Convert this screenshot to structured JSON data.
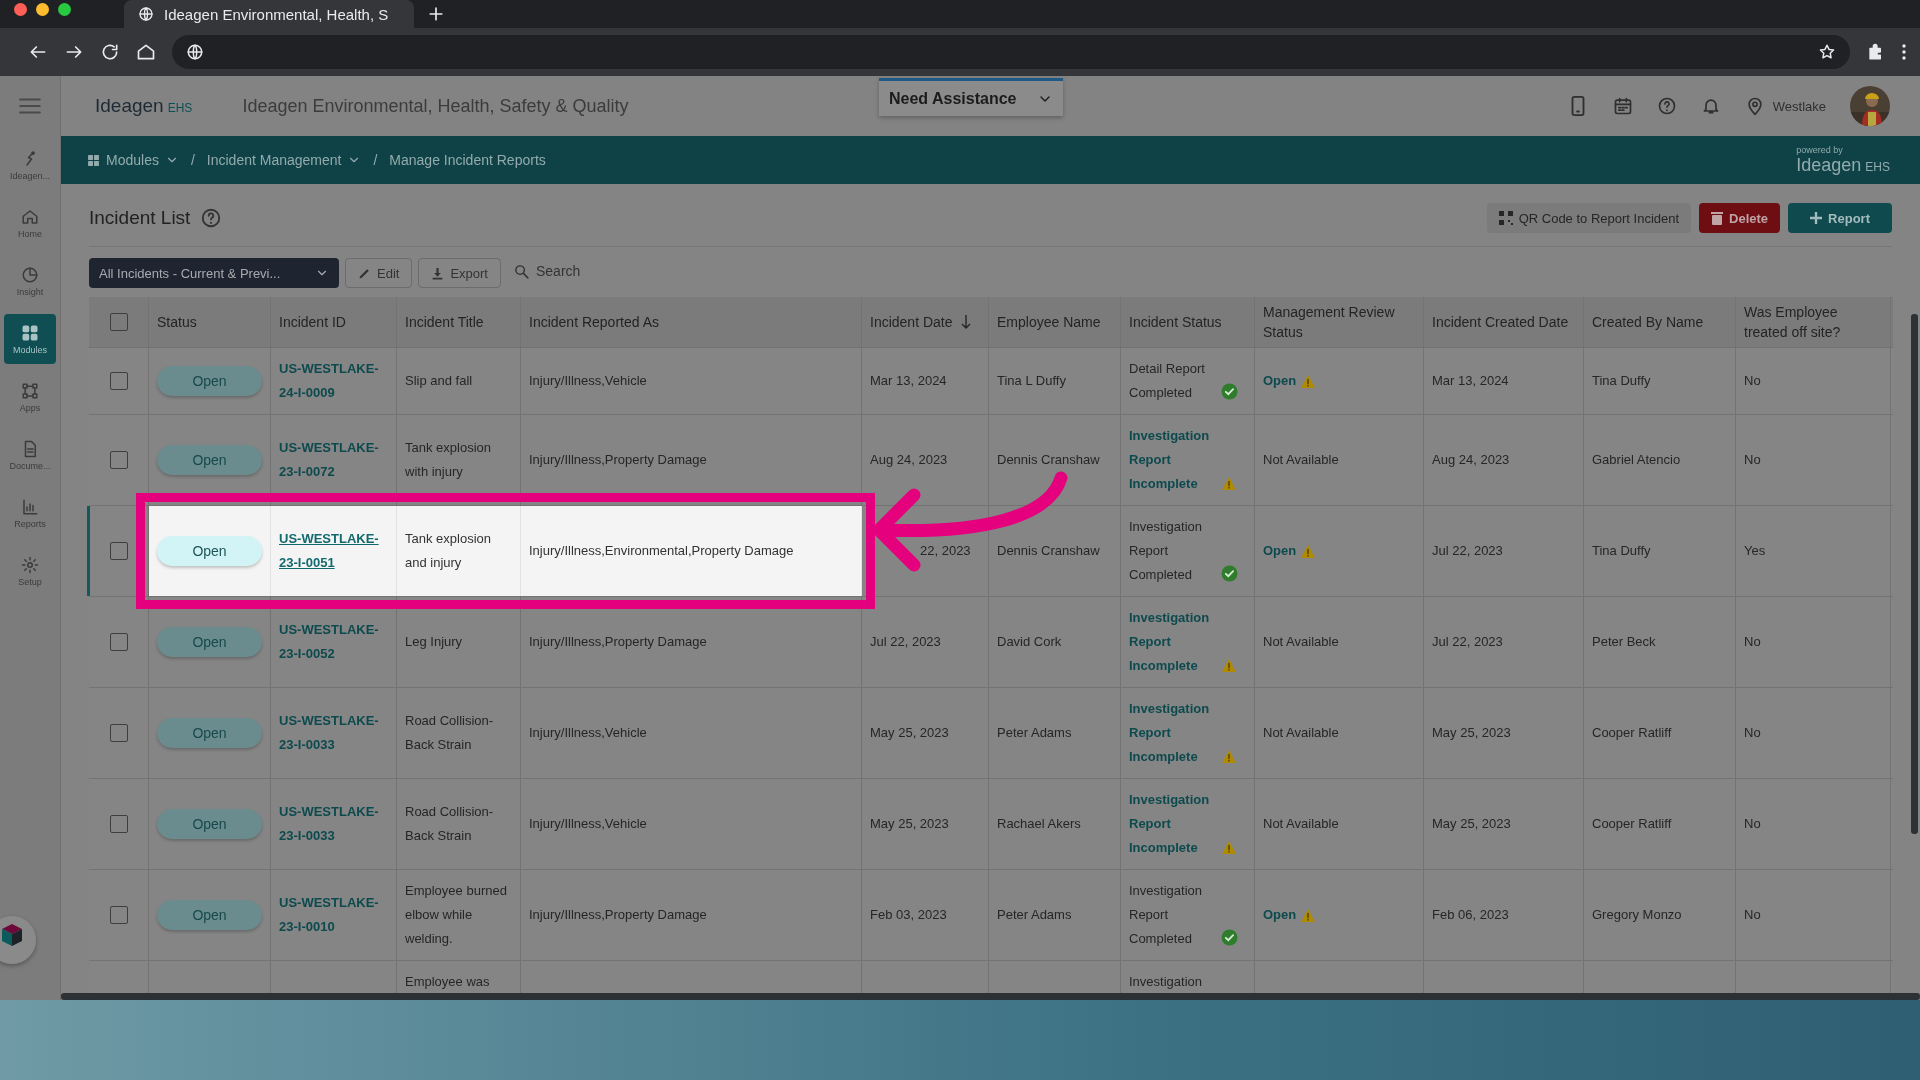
{
  "browser": {
    "tab_title": "Ideagen Environmental, Health, S"
  },
  "header": {
    "logo_text": "Ideagen",
    "logo_suffix": "EHS",
    "app_title": "Ideagen Environmental, Health, Safety & Quality",
    "assistance": "Need Assistance",
    "location": "Westlake"
  },
  "breadcrumb": [
    {
      "label": "Modules",
      "dropdown": true
    },
    {
      "label": "Incident Management",
      "dropdown": true
    },
    {
      "label": "Manage Incident Reports",
      "dropdown": false
    }
  ],
  "separator": "/",
  "powered_by": {
    "caption": "powered by",
    "logo_text": "Ideagen",
    "logo_suffix": "EHS"
  },
  "sidebar": {
    "items": [
      {
        "label": "Ideagen...",
        "kind": "brand",
        "selected": false
      },
      {
        "label": "Home",
        "kind": "home",
        "selected": false
      },
      {
        "label": "Insight",
        "kind": "insight",
        "selected": false
      },
      {
        "label": "Modules",
        "kind": "modules",
        "selected": true
      },
      {
        "label": "Apps",
        "kind": "apps",
        "selected": false
      },
      {
        "label": "Docume...",
        "kind": "document",
        "selected": false
      },
      {
        "label": "Reports",
        "kind": "reports",
        "selected": false
      },
      {
        "label": "Setup",
        "kind": "setup",
        "selected": false
      }
    ]
  },
  "page": {
    "title": "Incident List",
    "actions": [
      {
        "label": "QR Code to Report Incident",
        "kind": "qr"
      },
      {
        "label": "Delete",
        "kind": "delete"
      },
      {
        "label": "Report",
        "kind": "add"
      }
    ]
  },
  "toolbar": {
    "filter": "All Incidents - Current & Previ...",
    "buttons": [
      {
        "label": "Edit",
        "kind": "edit"
      },
      {
        "label": "Export",
        "kind": "export"
      }
    ],
    "search": "Search"
  },
  "table": {
    "header_checked": false,
    "columns": [
      {
        "label": "Status",
        "sorted": false
      },
      {
        "label": "Incident ID",
        "sorted": false
      },
      {
        "label": "Incident Title",
        "sorted": false
      },
      {
        "label": "Incident Reported As",
        "sorted": false
      },
      {
        "label": "Incident Date",
        "sorted": true
      },
      {
        "label": "Employee Name",
        "sorted": false
      },
      {
        "label": "Incident Status",
        "sorted": false
      },
      {
        "label": "Management Review Status",
        "sorted": false
      },
      {
        "label": "Incident Created Date",
        "sorted": false
      },
      {
        "label": "Created By Name",
        "sorted": false
      },
      {
        "label": "Was Employee treated off site?",
        "sorted": false
      }
    ],
    "rows": [
      {
        "selected": false,
        "checked": false,
        "status": "Open",
        "id": "US-WESTLAKE-24-I-0009",
        "title": "Slip and fall",
        "reported_as": "Injury/Illness,Vehicle",
        "date": "Mar 13, 2024",
        "employee": "Tina L Duffy",
        "incident_status": {
          "text": "Detail Report Completed",
          "kind": "complete"
        },
        "review": {
          "text": "Open",
          "kind": "open"
        },
        "created": "Mar 13, 2024",
        "created_by": "Tina Duffy",
        "treated": "No"
      },
      {
        "selected": false,
        "checked": false,
        "status": "Open",
        "id": "US-WESTLAKE-23-I-0072",
        "title": "Tank explosion with injury",
        "reported_as": "Injury/Illness,Property Damage",
        "date": "Aug 24, 2023",
        "employee": "Dennis Cranshaw",
        "incident_status": {
          "text": "Investigation Report Incomplete",
          "kind": "incomplete"
        },
        "review": {
          "text": "Not Available",
          "kind": "none"
        },
        "created": "Aug 24, 2023",
        "created_by": "Gabriel Atencio",
        "treated": "No"
      },
      {
        "selected": true,
        "checked": false,
        "status": "Open",
        "id": "US-WESTLAKE-23-I-0051",
        "title": "Tank explosion and injury",
        "reported_as": "Injury/Illness,Environmental,Property Damage",
        "date": "22, 2023",
        "employee": "Dennis Cranshaw",
        "incident_status": {
          "text": "Investigation Report Completed",
          "kind": "complete"
        },
        "review": {
          "text": "Open",
          "kind": "open"
        },
        "created": "Jul 22, 2023",
        "created_by": "Tina Duffy",
        "treated": "Yes"
      },
      {
        "selected": false,
        "checked": false,
        "status": "Open",
        "id": "US-WESTLAKE-23-I-0052",
        "title": "Leg Injury",
        "reported_as": "Injury/Illness,Property Damage",
        "date": "Jul 22, 2023",
        "employee": "David Cork",
        "incident_status": {
          "text": "Investigation Report Incomplete",
          "kind": "incomplete"
        },
        "review": {
          "text": "Not Available",
          "kind": "none"
        },
        "created": "Jul 22, 2023",
        "created_by": "Peter Beck",
        "treated": "No"
      },
      {
        "selected": false,
        "checked": false,
        "status": "Open",
        "id": "US-WESTLAKE-23-I-0033",
        "title": "Road Collision-Back Strain",
        "reported_as": "Injury/Illness,Vehicle",
        "date": "May 25, 2023",
        "employee": "Peter Adams",
        "incident_status": {
          "text": "Investigation Report Incomplete",
          "kind": "incomplete"
        },
        "review": {
          "text": "Not Available",
          "kind": "none"
        },
        "created": "May 25, 2023",
        "created_by": "Cooper Ratliff",
        "treated": "No"
      },
      {
        "selected": false,
        "checked": false,
        "status": "Open",
        "id": "US-WESTLAKE-23-I-0033",
        "title": "Road Collision-Back Strain",
        "reported_as": "Injury/Illness,Vehicle",
        "date": "May 25, 2023",
        "employee": "Rachael Akers",
        "incident_status": {
          "text": "Investigation Report Incomplete",
          "kind": "incomplete"
        },
        "review": {
          "text": "Not Available",
          "kind": "none"
        },
        "created": "May 25, 2023",
        "created_by": "Cooper Ratliff",
        "treated": "No"
      },
      {
        "selected": false,
        "checked": false,
        "status": "Open",
        "id": "US-WESTLAKE-23-I-0010",
        "title": "Employee burned elbow while welding.",
        "reported_as": "Injury/Illness,Property Damage",
        "date": "Feb 03, 2023",
        "employee": "Peter Adams",
        "incident_status": {
          "text": "Investigation Report Completed",
          "kind": "complete"
        },
        "review": {
          "text": "Open",
          "kind": "open"
        },
        "created": "Feb 06, 2023",
        "created_by": "Gregory Monzo",
        "treated": "No"
      },
      {
        "selected": false,
        "title": "Employee was",
        "incident_status": {
          "text": "Investigation",
          "kind": "plain"
        }
      }
    ]
  }
}
